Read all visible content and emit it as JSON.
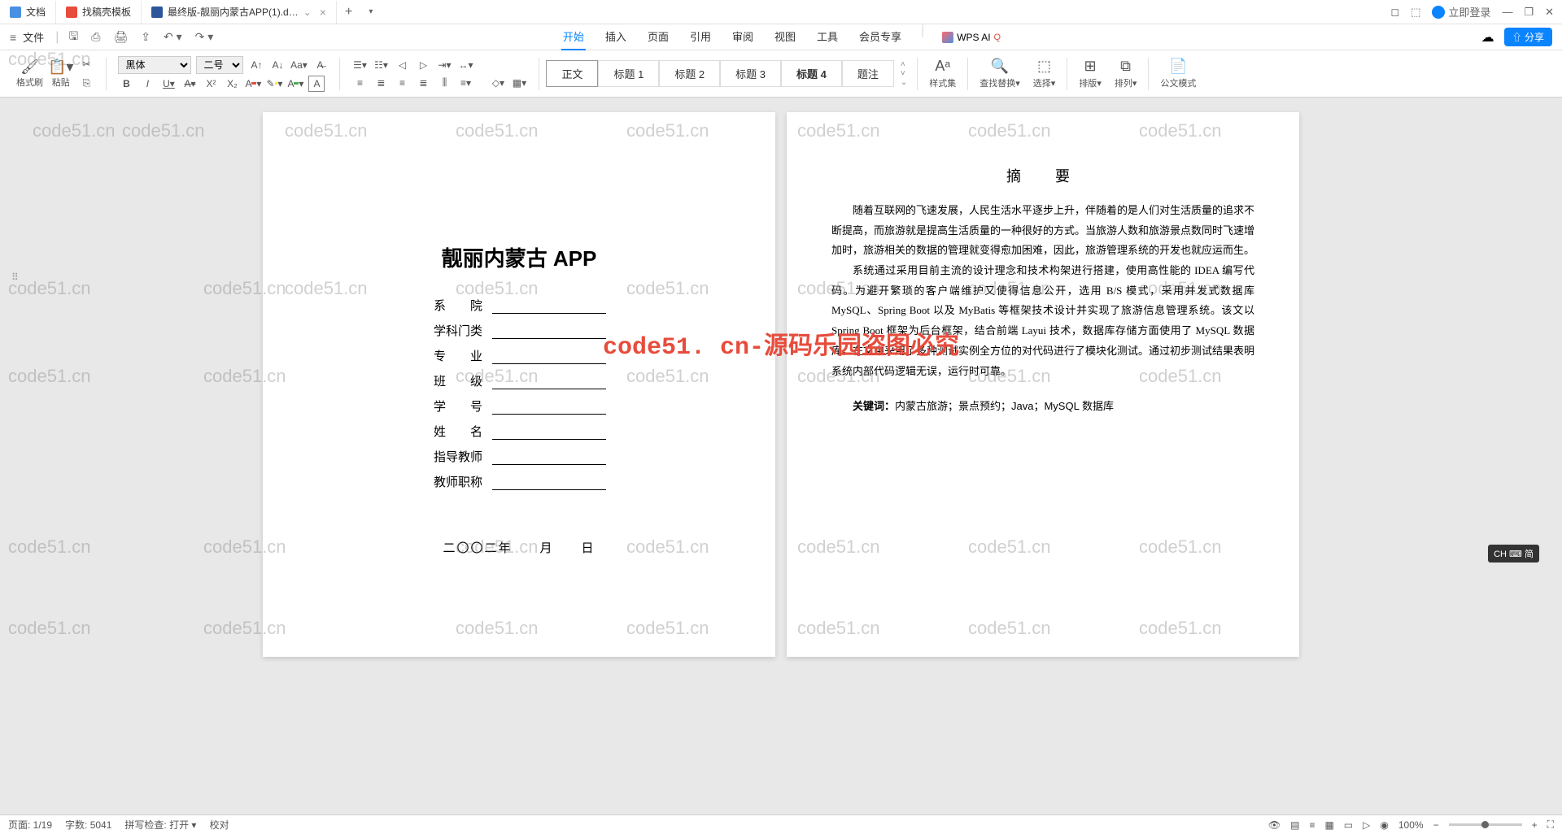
{
  "titlebar": {
    "tabs": [
      {
        "label": "文档",
        "icon": "doc"
      },
      {
        "label": "找稿壳模板",
        "icon": "red"
      },
      {
        "label": "最终版-靓丽内蒙古APP(1).d…",
        "icon": "word",
        "active": true
      }
    ],
    "login": "立即登录",
    "win_min": "—",
    "win_max": "❐",
    "win_close": "✕",
    "cube": "⬚",
    "box": "◻"
  },
  "menubar": {
    "file": "文件",
    "tabs": [
      "开始",
      "插入",
      "页面",
      "引用",
      "审阅",
      "视图",
      "工具",
      "会员专享"
    ],
    "active_tab": "开始",
    "wps_ai": "WPS AI",
    "cloud": "☁",
    "share": "分享"
  },
  "ribbon": {
    "format_painter": "格式刷",
    "paste": "粘贴",
    "font_name": "黑体",
    "font_size": "二号",
    "styles": {
      "body": "正文",
      "h1": "标题 1",
      "h2": "标题 2",
      "h3": "标题 3",
      "h4": "标题 4",
      "title": "题注"
    },
    "style_set": "样式集",
    "find_replace": "查找替换",
    "select": "选择",
    "sort": "排版",
    "arrange": "排列",
    "official_mode": "公文模式"
  },
  "page1": {
    "title": "靓丽内蒙古 APP",
    "fields": {
      "school": "系　　院",
      "category": "学科门类",
      "major": "专　　业",
      "class": "班　　级",
      "id": "学　　号",
      "name": "姓　　名",
      "advisor": "指导教师",
      "rank": "教师职称"
    },
    "date": "二〇〇二年　　月　　日"
  },
  "page2": {
    "title": "摘　要",
    "para1": "随着互联网的飞速发展，人民生活水平逐步上升，伴随着的是人们对生活质量的追求不断提高，而旅游就是提高生活质量的一种很好的方式。当旅游人数和旅游景点数同时飞速增加时，旅游相关的数据的管理就变得愈加困难，因此，旅游管理系统的开发也就应运而生。",
    "para2": "系统通过采用目前主流的设计理念和技术构架进行搭建，使用高性能的 IDEA 编写代码。为避开繁琐的客户端维护又使得信息公开，选用 B/S 模式，采用并发式数据库 MySQL、Spring Boot 以及 MyBatis 等框架技术设计并实现了旅游信息管理系统。该文以　　　　　　　Spring Boot 框架为后台框架，结合前端 Layui 技术，数据库存储方面使用了 MySQL 数据库。在文中采用了多种测试实例全方位的对代码进行了模块化测试。通过初步测试结果表明系统内部代码逻辑无误，运行时可靠。",
    "kw_label": "关键词：",
    "kw_value": "内蒙古旅游；景点预约；Java；MySQL 数据库"
  },
  "watermark_text": "code51.cn",
  "watermark_banner": "code51. cn-源码乐园盗图必究",
  "ime": "CH ⌨ 简",
  "statusbar": {
    "page": "页面: 1/19",
    "words": "字数: 5041",
    "spell": "拼写检查: 打开",
    "proof": "校对",
    "zoom": "100%"
  }
}
